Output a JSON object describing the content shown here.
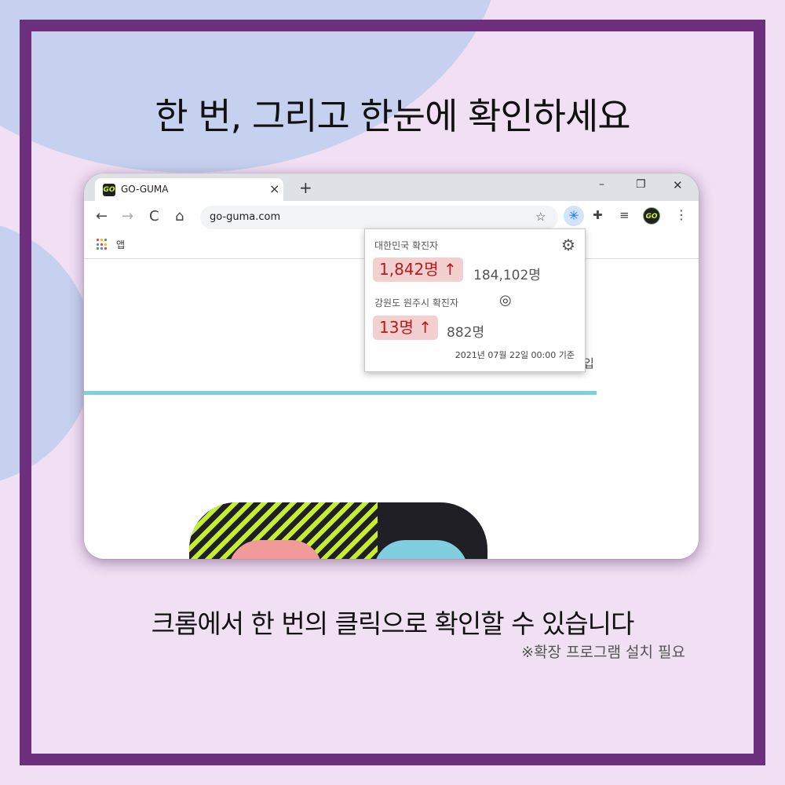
{
  "headline": "한 번, 그리고 한눈에 확인하세요",
  "browser": {
    "tab": {
      "favicon": "GO",
      "title": "GO-GUMA",
      "close_icon": "×"
    },
    "new_tab_icon": "+",
    "window_controls": {
      "minimize": "–",
      "restore": "❐",
      "close": "✕"
    },
    "nav": {
      "back": "←",
      "forward": "→",
      "reload": "C",
      "home": "⌂"
    },
    "url": "go-guma.com",
    "bookmark_icon": "☆",
    "extensions": {
      "active": "✳",
      "puzzle": "✚",
      "media": "≡",
      "avatar": "GO",
      "menu": "⋮"
    },
    "bookmarks": {
      "apps_label": "앱"
    },
    "page": {
      "partial_text": "입"
    }
  },
  "popup": {
    "national": {
      "label": "대한민국 확진자",
      "delta": "1,842명 ↑",
      "total": "184,102명"
    },
    "regional": {
      "label": "강원도 원주시 확진자",
      "delta": "13명 ↑",
      "total": "882명"
    },
    "gear_icon": "⚙",
    "locate_icon": "◎",
    "date": "2021년 07월 22일 00:00 기준"
  },
  "subtitle": "크롬에서 한 번의 클릭으로 확인할 수 있습니다",
  "note": "※확장 프로그램 설치 필요",
  "colors": {
    "background": "#f1dff4",
    "blob": "#c5d1ef",
    "border": "#6e2f7e",
    "delta_bg": "#f3d0d0",
    "delta_text": "#b61a1a",
    "accent_cyan": "#7fcfe0",
    "accent_lime": "#c5ee2c"
  }
}
